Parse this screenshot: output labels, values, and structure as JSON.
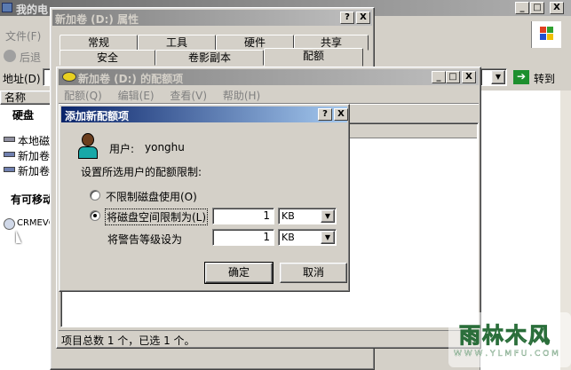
{
  "explorer": {
    "title": "我的电",
    "menu_file": "文件(F)",
    "back": "后退",
    "address_label": "地址(D)",
    "go_label": "转到",
    "col_name": "名称",
    "sections": [
      "硬盘",
      "有可移动"
    ],
    "drives": [
      "本地磁",
      "新加卷",
      "新加卷"
    ],
    "removable": "CRMEVC"
  },
  "props": {
    "title": "新加卷 (D:) 属性",
    "tabs_row1": [
      "常规",
      "工具",
      "硬件",
      "共享"
    ],
    "tabs_row2": [
      "安全",
      "卷影副本",
      "配额"
    ],
    "help_btn": "?",
    "close_btn": "X"
  },
  "quota": {
    "title": "新加卷 (D:) 的配额项",
    "menu": [
      "配额(Q)",
      "编辑(E)",
      "查看(V)",
      "帮助(H)"
    ],
    "status": "项目总数 1 个，已选 1 个。",
    "min_btn": "_",
    "max_btn": "□",
    "close_btn": "X"
  },
  "dialog": {
    "title": "添加新配额项",
    "help_btn": "?",
    "close_btn": "X",
    "user_label": "用户:",
    "user_name": "yonghu",
    "instruction": "设置所选用户的配额限制:",
    "opt_no_limit": "不限制磁盘使用(O)",
    "opt_limit": "将磁盘空间限制为(L)",
    "warn_label": "将警告等级设为",
    "limit_value": "1",
    "limit_unit": "KB",
    "warn_value": "1",
    "warn_unit": "KB",
    "ok": "确定",
    "cancel": "取消"
  },
  "watermark": {
    "text": "雨林木风",
    "url": "W W W . Y L M F U . C O M"
  },
  "colors": {
    "title_active": "#0a246a",
    "face": "#d4d0c8"
  }
}
